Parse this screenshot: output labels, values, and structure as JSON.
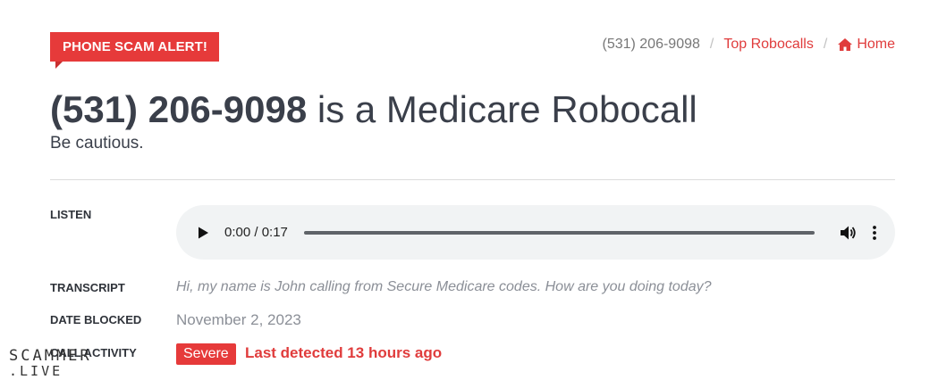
{
  "badge": {
    "label": "Phone Scam Alert!"
  },
  "breadcrumb": {
    "phone": "(531) 206-9098",
    "separator": "/",
    "top_robocalls": "Top Robocalls",
    "home": "Home"
  },
  "header": {
    "phone": "(531) 206-9098",
    "rest": " is a Medicare Robocall",
    "subtitle": "Be cautious."
  },
  "rows": {
    "listen": {
      "label": "Listen"
    },
    "transcript": {
      "label": "Transcript",
      "value": "Hi, my name is John calling from Secure Medicare codes. How are you doing today?"
    },
    "date_blocked": {
      "label": "Date Blocked",
      "value": "November 2, 2023"
    },
    "call_activity": {
      "label": "Call Activity",
      "severity": "Severe",
      "detected": "Last detected 13 hours ago"
    }
  },
  "audio": {
    "time": "0:00 / 0:17",
    "progress": 0.0,
    "icons": {
      "play": "play-icon",
      "volume": "volume-icon",
      "more": "more-vertical-icon"
    }
  },
  "watermark": {
    "top": "SCAMMER",
    "bottom": ".LIVE"
  },
  "colors": {
    "accent": "#e63a3a",
    "text": "#3a3f4a",
    "muted": "#8b8f97",
    "player_bg": "#f1f3f4"
  }
}
